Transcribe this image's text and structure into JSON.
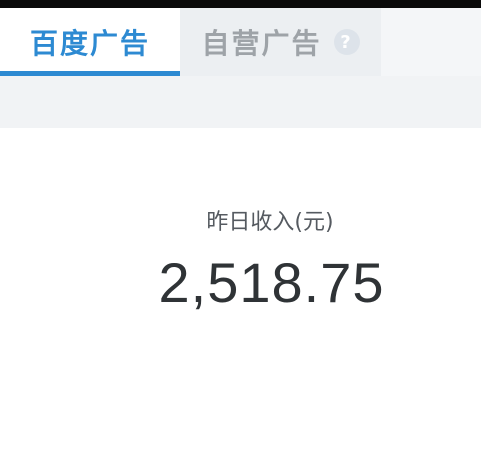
{
  "tabs": [
    {
      "label": "百度广告",
      "active": true
    },
    {
      "label": "自营广告",
      "active": false,
      "help_icon": "?"
    }
  ],
  "colors": {
    "accent": "#2d8ad2",
    "inactive_tab_text": "#9ea3a8",
    "value_text": "#2f3336"
  },
  "income": {
    "label": "昨日收入(元)",
    "value": "2,518.75"
  }
}
